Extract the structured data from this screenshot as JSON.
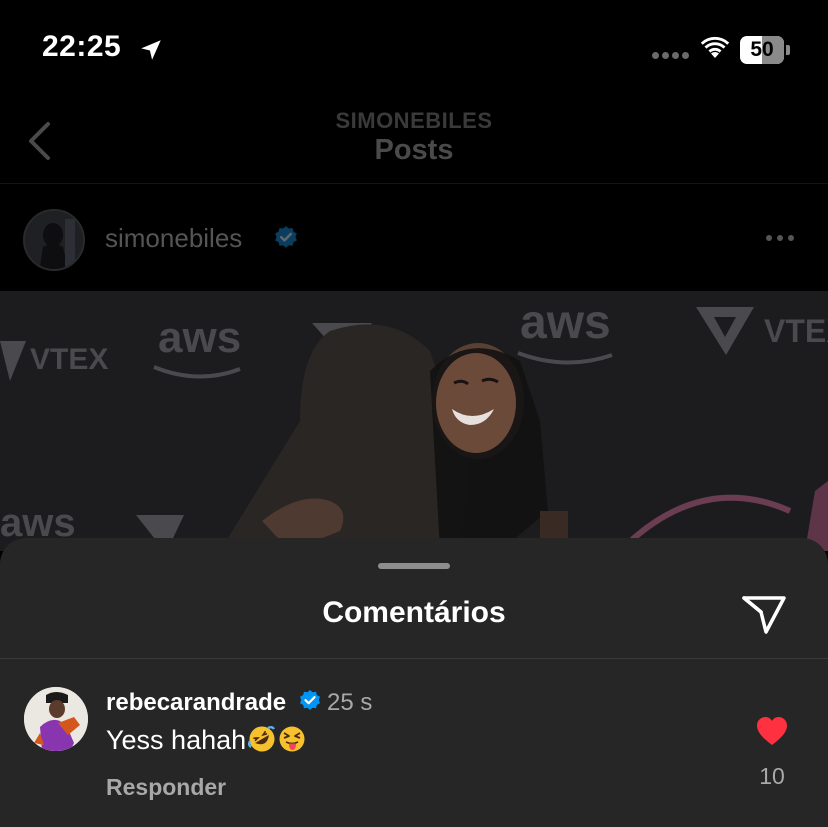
{
  "status_bar": {
    "time": "22:25",
    "battery": "50",
    "battery_level_percent": 50
  },
  "header": {
    "subtitle": "SIMONEBILES",
    "title": "Posts"
  },
  "post": {
    "username": "simonebiles",
    "verified": true
  },
  "photo_brands": {
    "aws": "aws",
    "vtex": "VTEX"
  },
  "comments_sheet": {
    "title": "Comentários",
    "comment": {
      "username": "rebecarandrade",
      "verified": true,
      "time": "25 s",
      "text": "Yess hahah",
      "emojis": [
        "rolling-on-floor-laughing",
        "squinting-face-with-tongue"
      ],
      "reply_label": "Responder",
      "likes": "10",
      "liked": true
    }
  },
  "colors": {
    "like_red": "#ff3040",
    "verified_blue": "#0095f6",
    "sheet_bg": "#262626"
  }
}
